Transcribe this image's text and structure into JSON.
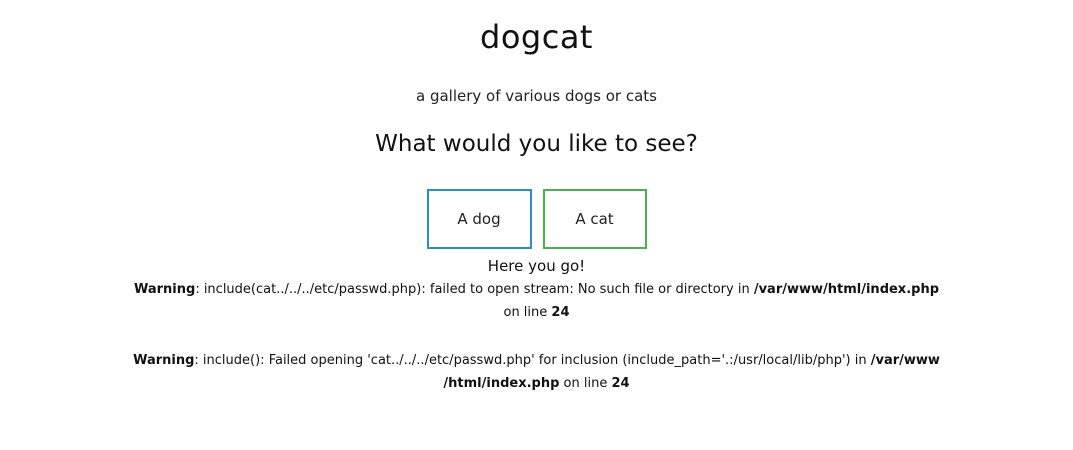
{
  "header": {
    "title": "dogcat",
    "subtitle": "a gallery of various dogs or cats"
  },
  "main": {
    "prompt": "What would you like to see?",
    "buttons": {
      "dog": "A dog",
      "cat": "A cat"
    },
    "result": "Here you go!"
  },
  "warnings": [
    {
      "label": "Warning",
      "line1_text": ": include(cat../../../etc/passwd.php): failed to open stream: No such file or directory in ",
      "path": "/var/www/html/index.php",
      "line2_text": " on line ",
      "line_number": "24"
    },
    {
      "label": "Warning",
      "line1_text": ": include(): Failed opening 'cat../../../etc/passwd.php' for inclusion (include_path='.:/usr/local/lib/php') in ",
      "path_part1": "/var/www",
      "path_part2": "/html/index.php",
      "line2_text": " on line ",
      "line_number": "24"
    }
  ],
  "colors": {
    "dog_border": "#2b8fc0",
    "cat_border": "#4cb050"
  }
}
